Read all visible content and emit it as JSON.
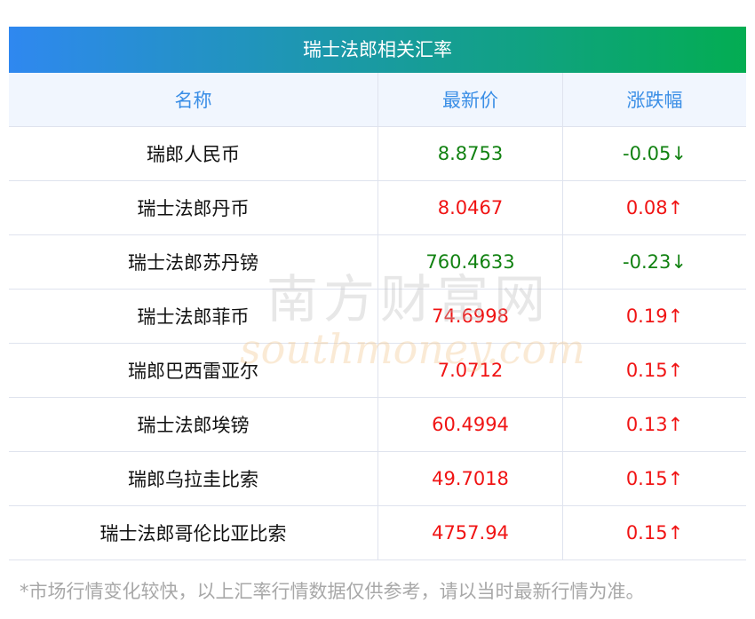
{
  "title": "瑞士法郎相关汇率",
  "headers": [
    "名称",
    "最新价",
    "涨跌幅"
  ],
  "rows": [
    {
      "name": "瑞郎人民币",
      "price": "8.8753",
      "change": "-0.05↓",
      "dir": "down"
    },
    {
      "name": "瑞士法郎丹币",
      "price": "8.0467",
      "change": "0.08↑",
      "dir": "up"
    },
    {
      "name": "瑞士法郎苏丹镑",
      "price": "760.4633",
      "change": "-0.23↓",
      "dir": "down"
    },
    {
      "name": "瑞士法郎菲币",
      "price": "74.6998",
      "change": "0.19↑",
      "dir": "up"
    },
    {
      "name": "瑞郎巴西雷亚尔",
      "price": "7.0712",
      "change": "0.15↑",
      "dir": "up"
    },
    {
      "name": "瑞士法郎埃镑",
      "price": "60.4994",
      "change": "0.13↑",
      "dir": "up"
    },
    {
      "name": "瑞郎乌拉圭比索",
      "price": "49.7018",
      "change": "0.15↑",
      "dir": "up"
    },
    {
      "name": "瑞士法郎哥伦比亚比索",
      "price": "4757.94",
      "change": "0.15↑",
      "dir": "up"
    }
  ],
  "footnote": "*市场行情变化较快，以上汇率行情数据仅供参考，请以当时最新行情为准。",
  "watermark": {
    "cn": "南方财富网",
    "en": "southmoney.com"
  },
  "colors": {
    "up": "#f01414",
    "down": "#128212",
    "header": "#3a8ee6"
  }
}
